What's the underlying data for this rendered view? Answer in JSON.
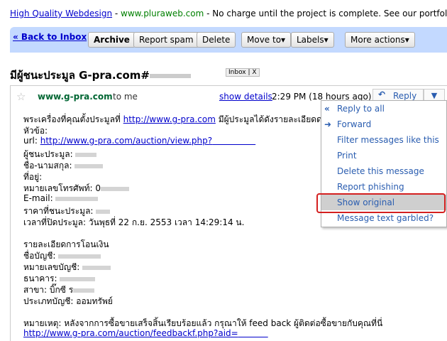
{
  "ad": {
    "title": "High Quality Webdesign",
    "sep": " - ",
    "url": "www.pluraweb.com",
    "text": " - No charge until the project is complete. See our portfolio"
  },
  "toolbar": {
    "back": "« Back to Inbox",
    "archive": "Archive",
    "spam": "Report spam",
    "delete": "Delete",
    "moveto": "Move to▾",
    "labels": "Labels▾",
    "more": "More actions▾"
  },
  "subject": {
    "text": "มีผู้ชนะประมูล G-pra.com#",
    "tag": "Inbox | X"
  },
  "message": {
    "sender": "www.g-pra.com",
    "to": "to me",
    "show_details": "show details",
    "time": "2:29 PM (18 hours ago)",
    "reply": "Reply",
    "dropdown": "▼",
    "lines": {
      "l1_a": "พระเครื่องที่คุณตั้งประมูลที่ ",
      "l1_link": "http://www.g-pra.com",
      "l1_b": " มีผู้ประมูลได้ดังรายละเอียดด",
      "l2": "หัวข้อ:",
      "l3_a": "url: ",
      "l3_link": "http://www.g-pra.com/auction/view.php?",
      "l4": "ผู้ชนะประมูล: ",
      "l5": "ชื่อ-นามสกุล: ",
      "l6": "ที่อยู่:",
      "l7": "หมายเลขโทรศัพท์: 0",
      "l8": "E-mail: ",
      "l9": "ราคาที่ชนะประมูล: ",
      "l10": "เวลาที่ปิดประมูล: วันพุธที่ 22 ก.ย. 2553 เวลา 14:29:14 น.",
      "l11": "รายละเอียดการโอนเงิน",
      "l12": "ชื่อบัญชี: ",
      "l13": "หมายเลขบัญชี: ",
      "l14": "ธนาคาร: ",
      "l15": "สาขา: บิ๊กซี ร",
      "l16": "ประเภทบัญชี: ออมทรัพย์",
      "l17": "หมายเหตุ: หลังจากการซื้อขายเสร็จสิ้นเรียบร้อยแล้ว กรุณาให้ feed back ผู้ติดต่อซื้อขายกับคุณที่นี่",
      "l18": "http://www.g-pra.com/auction/feedbackf.php?aid="
    }
  },
  "menu": {
    "items": [
      {
        "label": "Reply to all",
        "icon": "reply-all-icon",
        "glyph": "«"
      },
      {
        "label": "Forward",
        "icon": "forward-icon",
        "glyph": "➜"
      },
      {
        "label": "Filter messages like this"
      },
      {
        "label": "Print"
      },
      {
        "label": "Delete this message"
      },
      {
        "label": "Report phishing"
      },
      {
        "label": "Show original"
      },
      {
        "label": "Message text garbled?"
      }
    ]
  },
  "colors": {
    "toolbar_bg": "#c3d9ff",
    "link": "#0000cc",
    "highlight": "#d42020",
    "sender": "#006633"
  }
}
